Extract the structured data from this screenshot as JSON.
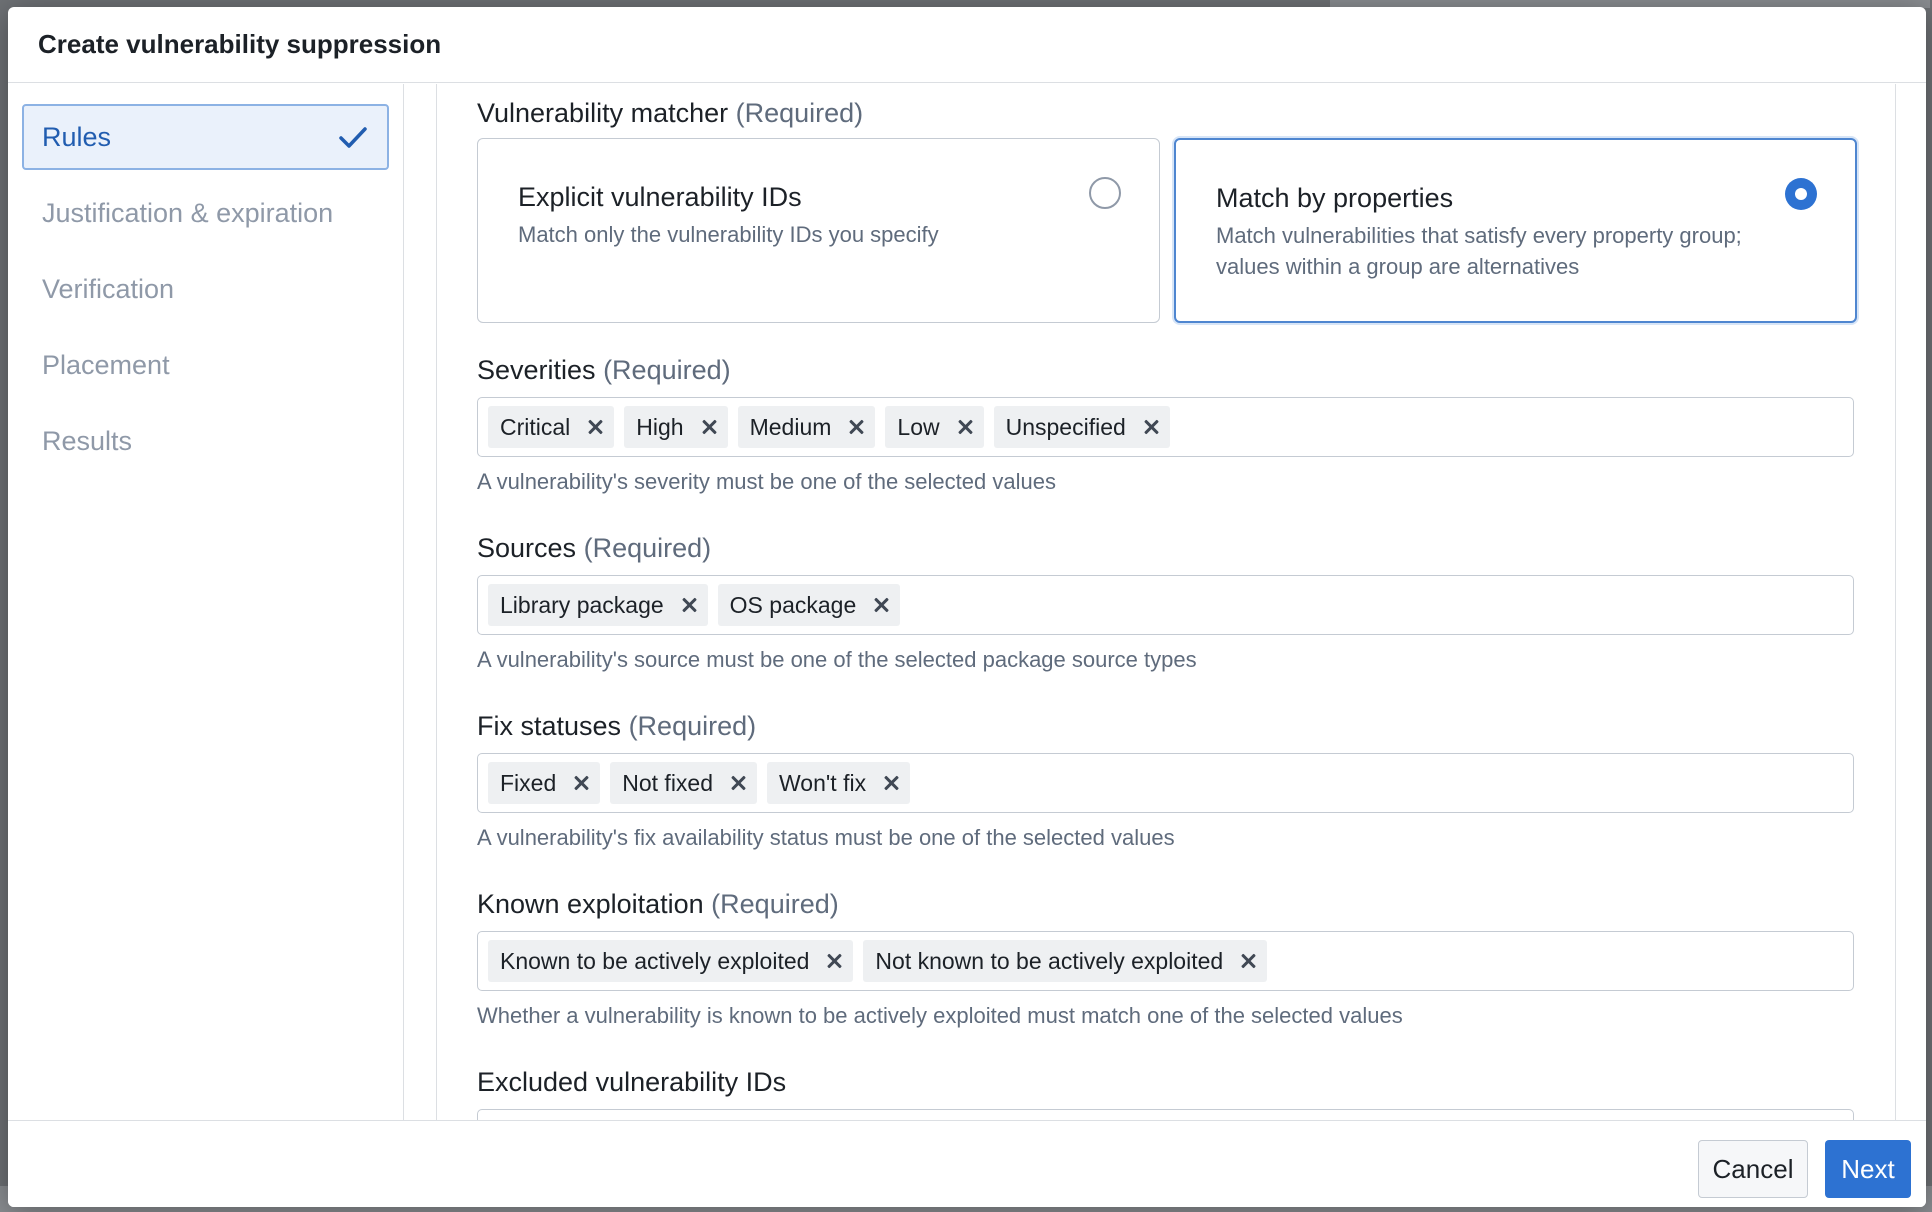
{
  "dialog": {
    "title": "Create vulnerability suppression"
  },
  "sidebar": {
    "steps": [
      {
        "label": "Rules",
        "active": true,
        "completed": true
      },
      {
        "label": "Justification & expiration",
        "active": false
      },
      {
        "label": "Verification",
        "active": false
      },
      {
        "label": "Placement",
        "active": false
      },
      {
        "label": "Results",
        "active": false
      }
    ]
  },
  "matcher": {
    "label": "Vulnerability matcher",
    "required": "(Required)",
    "options": [
      {
        "title": "Explicit vulnerability IDs",
        "description": "Match only the vulnerability IDs you specify",
        "selected": false
      },
      {
        "title": "Match by properties",
        "description": "Match vulnerabilities that satisfy every property group; values within a group are alternatives",
        "selected": true
      }
    ]
  },
  "fields": {
    "severities": {
      "label": "Severities",
      "required": "(Required)",
      "tags": [
        "Critical",
        "High",
        "Medium",
        "Low",
        "Unspecified"
      ],
      "help": "A vulnerability's severity must be one of the selected values"
    },
    "sources": {
      "label": "Sources",
      "required": "(Required)",
      "tags": [
        "Library package",
        "OS package"
      ],
      "help": "A vulnerability's source must be one of the selected package source types"
    },
    "fix_statuses": {
      "label": "Fix statuses",
      "required": "(Required)",
      "tags": [
        "Fixed",
        "Not fixed",
        "Won't fix"
      ],
      "help": "A vulnerability's fix availability status must be one of the selected values"
    },
    "known_exploitation": {
      "label": "Known exploitation",
      "required": "(Required)",
      "tags": [
        "Known to be actively exploited",
        "Not known to be actively exploited"
      ],
      "help": "Whether a vulnerability is known to be actively exploited must match one of the selected values"
    },
    "excluded_ids": {
      "label": "Excluded vulnerability IDs"
    }
  },
  "footer": {
    "cancel_label": "Cancel",
    "next_label": "Next"
  },
  "colors": {
    "accent": "#2d72d2",
    "active_step_bg": "#eaf1fb",
    "active_step_text": "#215db0",
    "muted_text": "#8f99a8"
  },
  "icons": {
    "completed_step": "checkmark-icon",
    "tag_remove": "close-icon"
  }
}
